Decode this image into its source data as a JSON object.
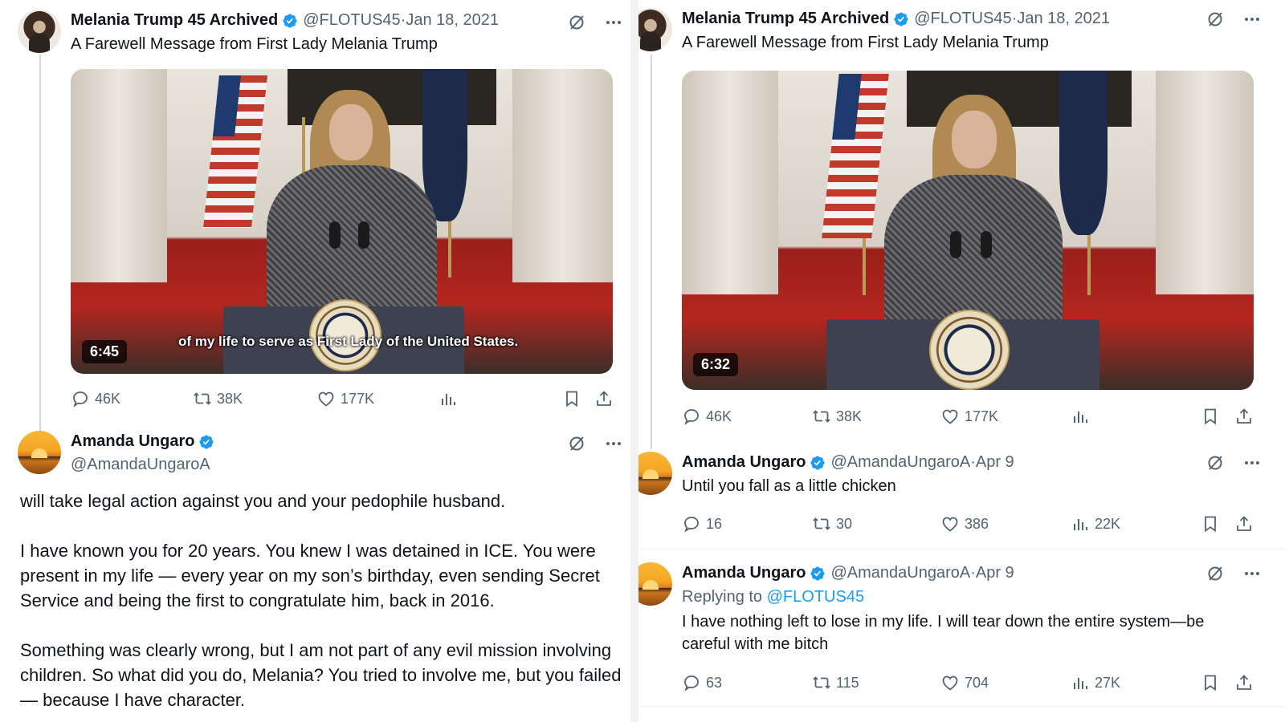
{
  "left": {
    "original_tweet": {
      "name": "Melania Trump 45 Archived",
      "handle": "@FLOTUS45",
      "date": "Jan 18, 2021",
      "text": "A Farewell Message from First Lady Melania Trump",
      "video_duration": "6:45",
      "video_caption": "of my life to serve as First Lady of the United States.",
      "stats": {
        "replies": "46K",
        "reposts": "38K",
        "likes": "177K"
      }
    },
    "reply": {
      "name": "Amanda Ungaro",
      "handle": "@AmandaUngaroA",
      "paragraphs": [
        "will take legal action against you and your pedophile husband.",
        "I have known you for 20 years. You knew I was detained in ICE. You were present in my life — every year on my son’s birthday, even sending Secret Service and being the first to congratulate him, back in 2016.",
        "Something was clearly wrong, but I am not part of any evil mission involving children. So what did you do, Melania? You tried to involve me, but you failed — because I have character."
      ]
    }
  },
  "right": {
    "original_tweet": {
      "name": "Melania Trump 45 Archived",
      "handle": "@FLOTUS45",
      "date": "Jan 18, 2021",
      "text": "A Farewell Message from First Lady Melania Trump",
      "video_duration": "6:32",
      "stats": {
        "replies": "46K",
        "reposts": "38K",
        "likes": "177K"
      }
    },
    "reply1": {
      "name": "Amanda Ungaro",
      "handle": "@AmandaUngaroA",
      "date": "Apr 9",
      "text": "Until you fall as a little chicken",
      "stats": {
        "replies": "16",
        "reposts": "30",
        "likes": "386",
        "views": "22K"
      }
    },
    "reply2": {
      "name": "Amanda Ungaro",
      "handle": "@AmandaUngaroA",
      "date": "Apr 9",
      "replying_prefix": "Replying to",
      "replying_handle": "@FLOTUS45",
      "text": "I have nothing left to lose in my life. I will tear down the entire system—be careful with me bitch",
      "stats": {
        "replies": "63",
        "reposts": "115",
        "likes": "704",
        "views": "27K"
      }
    }
  },
  "separator": " · ",
  "colors": {
    "verified": "#1d9bf0",
    "muted": "#536471",
    "link": "#1d9bf0"
  },
  "icons": [
    "verified-badge-icon",
    "grok-icon",
    "more-icon",
    "reply-icon",
    "repost-icon",
    "like-icon",
    "views-icon",
    "bookmark-icon",
    "share-icon"
  ]
}
